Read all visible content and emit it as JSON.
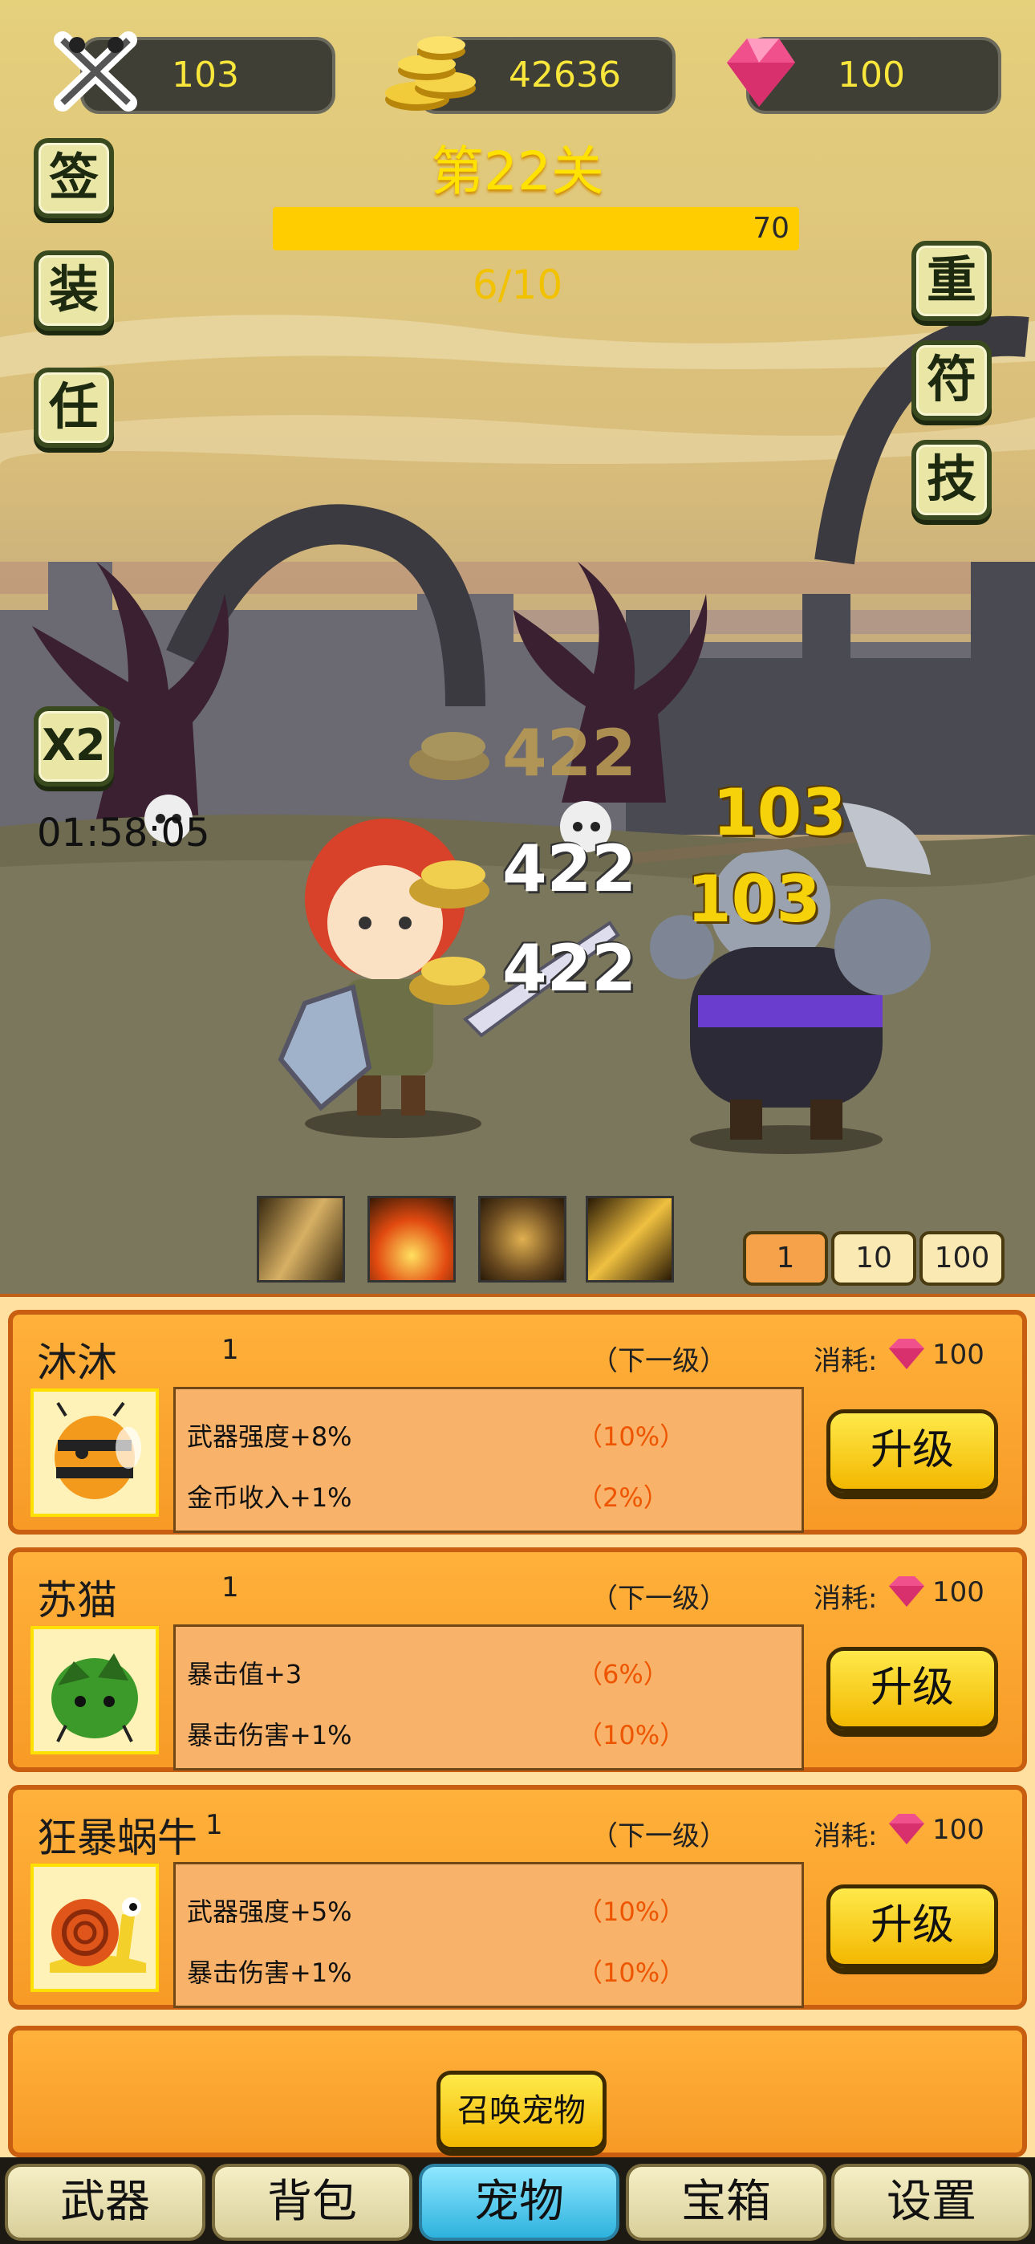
{
  "header": {
    "weapon_power": "103",
    "gold": "42636",
    "gems": "100"
  },
  "left_buttons": [
    "签",
    "装",
    "任",
    "X2"
  ],
  "right_buttons": [
    "重",
    "符",
    "技"
  ],
  "stage": {
    "title": "第22关",
    "hp_value": "70",
    "hp_fraction": 1.0,
    "wave": "6/10"
  },
  "timer": "01:58:05",
  "damage_numbers": {
    "player_faint": "422",
    "player_1": "422",
    "player_2": "422",
    "enemy_1": "103",
    "enemy_2": "103"
  },
  "multipliers": [
    "1",
    "10",
    "100"
  ],
  "pets": [
    {
      "name": "沐沐",
      "level": "1",
      "next_label": "（下一级）",
      "cost_label": "消耗:",
      "cost": "100",
      "stats": [
        {
          "label": "武器强度+8%",
          "next": "（10%）"
        },
        {
          "label": "金币收入+1%",
          "next": "（2%）"
        }
      ],
      "button": "升级",
      "portrait": "bee-pet-icon"
    },
    {
      "name": "苏猫",
      "level": "1",
      "next_label": "（下一级）",
      "cost_label": "消耗:",
      "cost": "100",
      "stats": [
        {
          "label": "暴击值+3",
          "next": "（6%）"
        },
        {
          "label": "暴击伤害+1%",
          "next": "（10%）"
        }
      ],
      "button": "升级",
      "portrait": "green-blob-pet-icon"
    },
    {
      "name": "狂暴蜗牛",
      "level": "1",
      "next_label": "（下一级）",
      "cost_label": "消耗:",
      "cost": "100",
      "stats": [
        {
          "label": "武器强度+5%",
          "next": "（10%）"
        },
        {
          "label": "暴击伤害+1%",
          "next": "（10%）"
        }
      ],
      "button": "升级",
      "portrait": "snail-pet-icon"
    }
  ],
  "summon_button": "召唤宠物",
  "tabs": [
    "武器",
    "背包",
    "宠物",
    "宝箱",
    "设置"
  ],
  "active_tab": "宠物",
  "colors": {
    "gold_text": "#ffe200",
    "card_orange": "#f79a26",
    "active_tab": "#2db2dd"
  }
}
